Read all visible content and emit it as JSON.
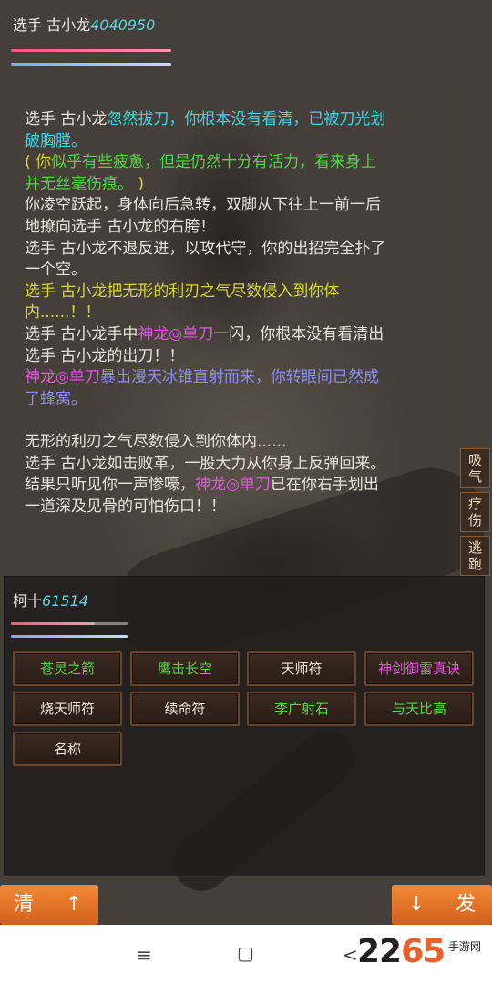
{
  "player": {
    "name": "选手  古小龙",
    "id_number": "4040950"
  },
  "log": {
    "lines": [
      [
        {
          "t": "选手  古小龙",
          "c": "c-pale"
        },
        {
          "t": "忽然拔刀，你根本没有看清，已被刀光划",
          "c": "c-cyan"
        }
      ],
      [
        {
          "t": "破胸膛。",
          "c": "c-cyan"
        }
      ],
      [
        {
          "t": "(  你",
          "c": "c-yellow"
        },
        {
          "t": "似乎有些疲惫，但是仍然十分有活力，看来身上",
          "c": "c-green"
        }
      ],
      [
        {
          "t": "并无丝毫伤痕。",
          "c": "c-green"
        },
        {
          "t": "  )",
          "c": "c-yellow"
        }
      ],
      [
        {
          "t": "你凌空跃起，身体向后急转，双脚从下往上一前一后",
          "c": "c-pale"
        }
      ],
      [
        {
          "t": "地撩向选手  古小龙的右胯！",
          "c": "c-pale"
        }
      ],
      [
        {
          "t": "选手  古小龙不退反进，以攻代守，你的出招完全扑了",
          "c": "c-pale"
        }
      ],
      [
        {
          "t": "一个空。",
          "c": "c-pale"
        }
      ],
      [
        {
          "t": "选手  古小龙把无形的利刃之气尽数侵入到你体",
          "c": "c-yellow"
        }
      ],
      [
        {
          "t": "内......！！",
          "c": "c-yellow"
        }
      ],
      [
        {
          "t": "选手  古小龙手中",
          "c": "c-pale"
        },
        {
          "t": "神龙◎单刀",
          "c": "c-magenta"
        },
        {
          "t": "一闪，你根本没有看清出",
          "c": "c-pale"
        }
      ],
      [
        {
          "t": "选手  古小龙的出刀！！",
          "c": "c-pale"
        }
      ],
      [
        {
          "t": "神龙◎单刀",
          "c": "c-magenta"
        },
        {
          "t": "暴出漫天冰锥直射而来，你转眼间已然成",
          "c": "c-blue"
        }
      ],
      [
        {
          "t": "了蜂窝。",
          "c": "c-blue"
        }
      ],
      [],
      [
        {
          "t": "无形的利刃之气尽数侵入到你体内......",
          "c": "c-pale"
        }
      ],
      [
        {
          "t": "选手  古小龙如击败革，一股大力从你身上反弹回来。",
          "c": "c-pale"
        }
      ],
      [
        {
          "t": "结果只听见你一声惨嚎，",
          "c": "c-pale"
        },
        {
          "t": "神龙◎单刀",
          "c": "c-magenta"
        },
        {
          "t": "已在你右手划出",
          "c": "c-pale"
        }
      ],
      [
        {
          "t": "一道深及见骨的可怕伤口！！",
          "c": "c-pale"
        }
      ]
    ]
  },
  "side_buttons": [
    "吸\n气",
    "疗\n伤",
    "逃\n跑"
  ],
  "enemy": {
    "name": "柯十",
    "id_number": "61514"
  },
  "skills": [
    {
      "label": "苍灵之箭",
      "color": "#55d24a"
    },
    {
      "label": "鹰击长空",
      "color": "#55d24a"
    },
    {
      "label": "天师符",
      "color": "#ece6dc"
    },
    {
      "label": "神剑御雷真诀",
      "color": "#e058e0"
    },
    {
      "label": "烧天师符",
      "color": "#ece6dc"
    },
    {
      "label": "续命符",
      "color": "#ece6dc"
    },
    {
      "label": "李广射石",
      "color": "#55d24a"
    },
    {
      "label": "与天比高",
      "color": "#55d24a"
    },
    {
      "label": "名称",
      "color": "#ece6dc"
    }
  ],
  "bottom": {
    "clear_label": "清",
    "up_label": "↑",
    "down_label": "↓",
    "send_label": "发"
  },
  "navbar": {
    "menu_icon": "≡",
    "home_icon": "▢",
    "back_icon": "<"
  },
  "watermark": {
    "brand_a": "22",
    "brand_b": "65",
    "suffix": "手游网"
  },
  "health_bars": {
    "player_hp": 1.0,
    "player_mp": 1.0,
    "enemy_hp": 0.72,
    "enemy_mp": 1.0
  }
}
